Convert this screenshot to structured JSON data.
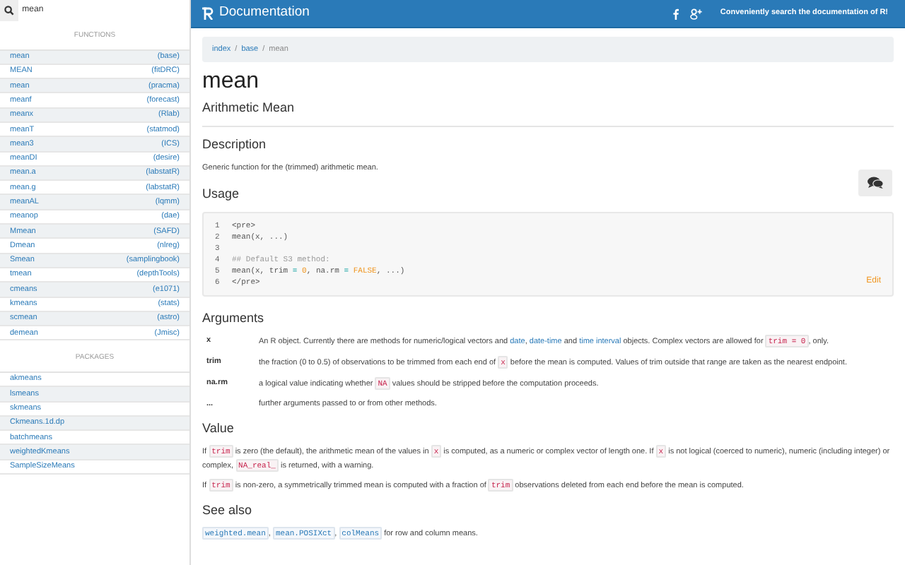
{
  "search": {
    "value": "mean"
  },
  "functions_heading": "FUNCTIONS",
  "functions": [
    {
      "name": "mean",
      "package": "(base)"
    },
    {
      "name": "MEAN",
      "package": "(fitDRC)"
    },
    {
      "name": "mean",
      "package": "(pracma)"
    },
    {
      "name": "meanf",
      "package": "(forecast)"
    },
    {
      "name": "meanx",
      "package": "(Rlab)"
    },
    {
      "name": "meanT",
      "package": "(statmod)"
    },
    {
      "name": "mean3",
      "package": "(ICS)"
    },
    {
      "name": "meanDI",
      "package": "(desire)"
    },
    {
      "name": "mean.a",
      "package": "(labstatR)"
    },
    {
      "name": "mean.g",
      "package": "(labstatR)"
    },
    {
      "name": "meanAL",
      "package": "(lqmm)"
    },
    {
      "name": "meanop",
      "package": "(dae)"
    },
    {
      "name": "Mmean",
      "package": "(SAFD)"
    },
    {
      "name": "Dmean",
      "package": "(nlreg)"
    },
    {
      "name": "Smean",
      "package": "(samplingbook)"
    },
    {
      "name": "tmean",
      "package": "(depthTools)"
    },
    {
      "name": "cmeans",
      "package": "(e1071)"
    },
    {
      "name": "kmeans",
      "package": "(stats)"
    },
    {
      "name": "scmean",
      "package": "(astro)"
    },
    {
      "name": "demean",
      "package": "(Jmisc)"
    }
  ],
  "packages_heading": "PACKAGES",
  "packages": [
    "akmeans",
    "lsmeans",
    "skmeans",
    "Ckmeans.1d.dp",
    "batchmeans",
    "weightedKmeans",
    "SampleSizeMeans"
  ],
  "header": {
    "title": "Documentation",
    "tagline": "Conveniently search the documentation of R!"
  },
  "breadcrumb": [
    {
      "kind": "link",
      "label": "index"
    },
    {
      "kind": "separator",
      "label": "/"
    },
    {
      "kind": "link",
      "label": "base"
    },
    {
      "kind": "separator",
      "label": "/"
    },
    {
      "kind": "current",
      "label": "mean"
    }
  ],
  "title": "mean",
  "subtitle": "Arithmetic Mean",
  "description": {
    "heading": "Description",
    "text": "Generic function for the (trimmed) arithmetic mean."
  },
  "usage": {
    "heading": "Usage",
    "edit": "Edit",
    "lines": [
      {
        "number": "1",
        "tokens": [
          {
            "kind": "plain",
            "text": "<pre>"
          }
        ]
      },
      {
        "number": "2",
        "tokens": [
          {
            "kind": "plain",
            "text": "mean(x, ...)"
          }
        ]
      },
      {
        "number": "3"
      },
      {
        "number": "4",
        "tokens": [
          {
            "kind": "comment",
            "text": "## Default S3 method:"
          }
        ]
      },
      {
        "number": "5",
        "tokens": [
          {
            "kind": "plain",
            "text": "mean(x, trim "
          },
          {
            "kind": "operator",
            "text": "= "
          },
          {
            "kind": "literal",
            "text": "0"
          },
          {
            "kind": "plain",
            "text": ", na.rm "
          },
          {
            "kind": "operator",
            "text": "= "
          },
          {
            "kind": "literal",
            "text": "FALSE"
          },
          {
            "kind": "plain",
            "text": ", ...)"
          }
        ]
      },
      {
        "number": "6",
        "tokens": [
          {
            "kind": "plain",
            "text": "</pre>"
          }
        ]
      }
    ]
  },
  "arguments": {
    "heading": "Arguments",
    "items": [
      {
        "name": "x",
        "text": [
          {
            "kind": "text",
            "text": "An R object. Currently there are methods for numeric/logical vectors and "
          },
          {
            "kind": "link",
            "text": "date"
          },
          {
            "kind": "text",
            "text": ", "
          },
          {
            "kind": "link",
            "text": "date-time"
          },
          {
            "kind": "text",
            "text": " and "
          },
          {
            "kind": "link",
            "text": "time interval"
          },
          {
            "kind": "text",
            "text": " objects. Complex vectors are allowed for "
          },
          {
            "kind": "code",
            "text": "trim = 0"
          },
          {
            "kind": "text",
            "text": ", only."
          }
        ]
      },
      {
        "name": "trim",
        "text": [
          {
            "kind": "text",
            "text": "the fraction (0 to 0.5) of observations to be trimmed from each end of "
          },
          {
            "kind": "code",
            "text": "x"
          },
          {
            "kind": "text",
            "text": " before the mean is computed. Values of trim outside that range are taken as the nearest endpoint."
          }
        ]
      },
      {
        "name": "na.rm",
        "text": [
          {
            "kind": "text",
            "text": "a logical value indicating whether "
          },
          {
            "kind": "code",
            "text": "NA"
          },
          {
            "kind": "text",
            "text": " values should be stripped before the computation proceeds."
          }
        ]
      },
      {
        "name": "...",
        "text": [
          {
            "kind": "text",
            "text": "further arguments passed to or from other methods."
          }
        ]
      }
    ]
  },
  "value": {
    "heading": "Value",
    "paragraphs": [
      [
        {
          "kind": "text",
          "text": "If "
        },
        {
          "kind": "code",
          "text": "trim"
        },
        {
          "kind": "text",
          "text": " is zero (the default), the arithmetic mean of the values in "
        },
        {
          "kind": "code",
          "text": "x"
        },
        {
          "kind": "text",
          "text": " is computed, as a numeric or complex vector of length one. If "
        },
        {
          "kind": "code",
          "text": "x"
        },
        {
          "kind": "text",
          "text": " is not logical (coerced to numeric), numeric (including integer) or complex, "
        },
        {
          "kind": "code",
          "text": "NA_real_"
        },
        {
          "kind": "text",
          "text": " is returned, with a warning."
        }
      ],
      [
        {
          "kind": "text",
          "text": "If "
        },
        {
          "kind": "code",
          "text": "trim"
        },
        {
          "kind": "text",
          "text": " is non-zero, a symmetrically trimmed mean is computed with a fraction of "
        },
        {
          "kind": "code",
          "text": "trim"
        },
        {
          "kind": "text",
          "text": " observations deleted from each end before the mean is computed."
        }
      ]
    ]
  },
  "see_also": {
    "heading": "See also",
    "text": [
      {
        "kind": "codelink",
        "text": "weighted.mean"
      },
      {
        "kind": "text",
        "text": ", "
      },
      {
        "kind": "codelink",
        "text": "mean.POSIXct"
      },
      {
        "kind": "text",
        "text": ", "
      },
      {
        "kind": "codelink",
        "text": "colMeans"
      },
      {
        "kind": "text",
        "text": " for row and column means."
      }
    ]
  }
}
